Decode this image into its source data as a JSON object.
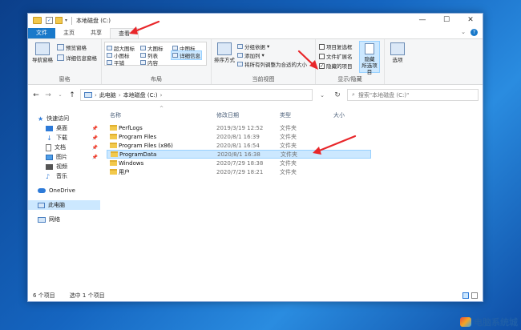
{
  "window": {
    "title": "本地磁盘 (C:)",
    "controls": [
      "—",
      "☐",
      "✕"
    ]
  },
  "tabs": [
    "文件",
    "主页",
    "共享",
    "查看"
  ],
  "ribbon": {
    "panes": {
      "nav_pane": "导航窗格",
      "preview_pane": "预览窗格",
      "details_pane": "详细信息窗格",
      "label": "窗格"
    },
    "layout": {
      "items": [
        "超大图标",
        "大图标",
        "中图标",
        "小图标",
        "列表",
        "详细信息",
        "平铺",
        "内容"
      ],
      "label": "布局"
    },
    "current_view": {
      "sort_by": "排序方式",
      "group_by": "分组依据",
      "add_column": "添加列",
      "fit_columns": "将所有列调整为合适的大小",
      "label": "当前视图"
    },
    "show_hide": {
      "item_checkboxes": "项目复选框",
      "file_extensions": "文件扩展名",
      "hidden_items": "隐藏的项目",
      "hide_selected_1": "隐藏",
      "hide_selected_2": "所选项目",
      "label": "显示/隐藏"
    },
    "options": "选项"
  },
  "address": {
    "breadcrumb": [
      "此电脑",
      "本地磁盘 (C:)"
    ],
    "search_placeholder": "搜索\"本地磁盘 (C:)\""
  },
  "nav_pane": {
    "quick_access": "快速访问",
    "quick_items": [
      "桌面",
      "下载",
      "文档",
      "图片",
      "视频",
      "音乐"
    ],
    "onedrive": "OneDrive",
    "this_pc": "此电脑",
    "network": "网络"
  },
  "columns": {
    "name": "名称",
    "modified": "修改日期",
    "type": "类型",
    "size": "大小"
  },
  "files": [
    {
      "name": "PerfLogs",
      "date": "2019/3/19 12:52",
      "type": "文件夹"
    },
    {
      "name": "Program Files",
      "date": "2020/8/1 16:39",
      "type": "文件夹"
    },
    {
      "name": "Program Files (x86)",
      "date": "2020/8/1 16:54",
      "type": "文件夹"
    },
    {
      "name": "ProgramData",
      "date": "2020/8/1 16:38",
      "type": "文件夹"
    },
    {
      "name": "Windows",
      "date": "2020/7/29 18:38",
      "type": "文件夹"
    },
    {
      "name": "用户",
      "date": "2020/7/29 18:21",
      "type": "文件夹"
    }
  ],
  "status": {
    "count": "6 个项目",
    "selected": "选中 1 个项目"
  },
  "watermark": "电脑系统城",
  "colors": {
    "file_tab": "#1979ca",
    "selection": "#cce8ff",
    "annotation": "#e8262a",
    "desktop": "#1565c0"
  }
}
